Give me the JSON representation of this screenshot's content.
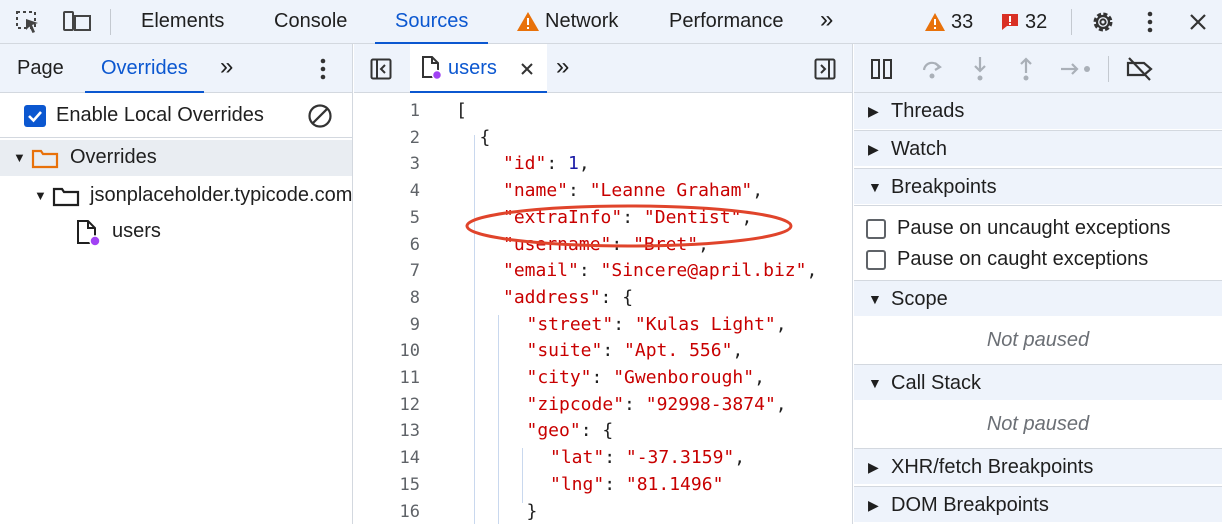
{
  "toolbar": {
    "tabs": [
      "Elements",
      "Console",
      "Sources",
      "Network",
      "Performance"
    ],
    "active_tab": "Sources",
    "more_tabs": "»",
    "warnings_count": "33",
    "issues_count": "32"
  },
  "navigator": {
    "tabs": [
      "Page",
      "Overrides"
    ],
    "active_tab": "Overrides",
    "enable_overrides_label": "Enable Local Overrides",
    "enable_overrides_checked": true,
    "tree": {
      "root_label": "Overrides",
      "domain_label": "jsonplaceholder.typicode.com",
      "file_label": "users"
    }
  },
  "editor": {
    "tab_label": "users",
    "lines": [
      {
        "num": "1",
        "text": "["
      },
      {
        "num": "2",
        "text": "{"
      },
      {
        "num": "3",
        "key": "\"id\"",
        "value": "1",
        "value_type": "number",
        "suffix": ","
      },
      {
        "num": "4",
        "key": "\"name\"",
        "value": "\"Leanne Graham\"",
        "value_type": "string",
        "suffix": ","
      },
      {
        "num": "5",
        "key": "\"extraInfo\"",
        "value": "\"Dentist\"",
        "value_type": "string",
        "suffix": ","
      },
      {
        "num": "6",
        "key": "\"username\"",
        "value": "\"Bret\"",
        "value_type": "string",
        "suffix": ","
      },
      {
        "num": "7",
        "key": "\"email\"",
        "value": "\"Sincere@april.biz\"",
        "value_type": "string",
        "suffix": ","
      },
      {
        "num": "8",
        "key": "\"address\"",
        "value": "{",
        "value_type": "punct",
        "suffix": ""
      },
      {
        "num": "9",
        "key": "\"street\"",
        "value": "\"Kulas Light\"",
        "value_type": "string",
        "suffix": ","
      },
      {
        "num": "10",
        "key": "\"suite\"",
        "value": "\"Apt. 556\"",
        "value_type": "string",
        "suffix": ","
      },
      {
        "num": "11",
        "key": "\"city\"",
        "value": "\"Gwenborough\"",
        "value_type": "string",
        "suffix": ","
      },
      {
        "num": "12",
        "key": "\"zipcode\"",
        "value": "\"92998-3874\"",
        "value_type": "string",
        "suffix": ","
      },
      {
        "num": "13",
        "key": "\"geo\"",
        "value": "{",
        "value_type": "punct",
        "suffix": ""
      },
      {
        "num": "14",
        "key": "\"lat\"",
        "value": "\"-37.3159\"",
        "value_type": "string",
        "suffix": ","
      },
      {
        "num": "15",
        "key": "\"lng\"",
        "value": "\"81.1496\"",
        "value_type": "string",
        "suffix": ""
      },
      {
        "num": "16",
        "text": "}"
      }
    ],
    "highlighted_line": "5",
    "highlight_color": "#e0442b"
  },
  "debugger": {
    "threads_label": "Threads",
    "watch_label": "Watch",
    "breakpoints_label": "Breakpoints",
    "pause_uncaught_label": "Pause on uncaught exceptions",
    "pause_caught_label": "Pause on caught exceptions",
    "scope_label": "Scope",
    "scope_status": "Not paused",
    "callstack_label": "Call Stack",
    "callstack_status": "Not paused",
    "xhr_label": "XHR/fetch Breakpoints",
    "dom_label": "DOM Breakpoints"
  },
  "colors": {
    "accent": "#0b57d0",
    "warning": "#e8710a",
    "issue": "#d93025",
    "folder": "#e8710a",
    "json_key": "#c80000",
    "json_number": "#1a1aa6"
  }
}
